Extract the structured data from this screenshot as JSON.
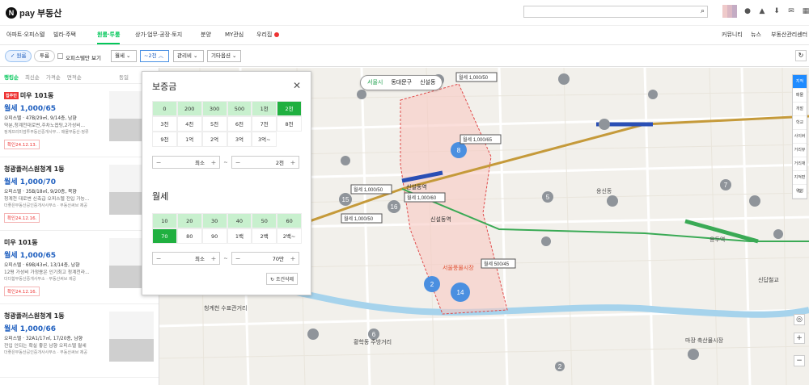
{
  "header": {
    "brand_letter": "N",
    "brand": "pay 부동산",
    "search_placeholder": ""
  },
  "topicons": [
    "chat-icon",
    "bell-icon",
    "download-icon",
    "mail-icon",
    "grid-icon"
  ],
  "nav": {
    "items": [
      "아파트·오피스텔",
      "빌라·주택",
      "원룸·투룸",
      "상가·업무·공장·토지",
      "분양",
      "MY관심",
      "우리집"
    ],
    "active_index": 2,
    "right": [
      "커뮤니티",
      "뉴스",
      "부동산관리센터"
    ]
  },
  "filters": {
    "chip_1": "✓ 원룸",
    "chip_2": "투룸",
    "checkbox_label": "오피스텔만 보기",
    "deal_select": "월세",
    "price_select": "~2천",
    "manage_select": "관리비",
    "other_select": "기타옵션"
  },
  "sort": [
    "랭킹순",
    "최신순",
    "가격순",
    "면적순"
  ],
  "sort_extra": "동일",
  "listings": [
    {
      "tag": "집주인",
      "title": "미우 101동",
      "price": "월세 1,000/65",
      "spec": "오피스텔 · 47B/29㎡, 9/14층, 남향",
      "desc": "약분,청계천대로변,주차노옵팅,2가성비...",
      "agent": "정계프리미엄투부동산중개사무...  매물부동산·정류",
      "date": "확인24.12.13."
    },
    {
      "tag": "",
      "title": "청광플러스원청계 1동",
      "price": "월세 1,000/70",
      "spec": "오피스텔 · 35B/18㎡, 9/20층, 북향",
      "desc": "청계천 대로변 신축급 오피스텔 전입 가능...",
      "agent": "더좋은부동산공인중개사사무소 · 부동산써브 제공",
      "date": "확인24.12.16."
    },
    {
      "tag": "",
      "title": "미우 101동",
      "price": "월세 1,000/65",
      "spec": "오피스텔 · 69B/43㎡, 13/14층, 남향",
      "desc": "12평 가성비 가정용은 인기최고 청계천라...",
      "agent": "더더함부동산중개사무소 · 부동산써브 제공",
      "date": "확인24.12.16."
    },
    {
      "tag": "",
      "title": "청광플러스원청계 1동",
      "price": "월세 1,000/66",
      "spec": "오피스텔 · 32A1/17㎡, 17/20층, 남향",
      "desc": "전입 인되는 확실 좋은 남향 오피스텔 월세",
      "agent": "더좋은부동산공인중개사사무소 · 부동산써브 제공",
      "date": ""
    }
  ],
  "panel": {
    "deposit_title": "보증금",
    "deposit_options": [
      "0",
      "200",
      "300",
      "500",
      "1천",
      "2천",
      "3천",
      "4천",
      "5천",
      "6천",
      "7천",
      "8천",
      "9천",
      "1억",
      "2억",
      "3억",
      "3억~"
    ],
    "deposit_min": "최소",
    "deposit_max": "2천",
    "rent_title": "월세",
    "rent_options": [
      "10",
      "20",
      "30",
      "40",
      "50",
      "60",
      "70",
      "80",
      "90",
      "1백",
      "2백",
      "2백~"
    ],
    "rent_min": "최소",
    "rent_max": "70만",
    "tilde": "~",
    "reset": "조건삭제"
  },
  "location": {
    "city": "서울시",
    "gu": "동대문구",
    "dong": "신설동"
  },
  "map_labels": [
    "월세 1,000/50",
    "월세 1,000/65",
    "월세 1,000/50",
    "월세 1,000/60",
    "월세 1,000/50",
    "월세 500/45",
    "월세 1,000/50",
    "신설동역",
    "신설동역",
    "용신동",
    "용두역",
    "서울풍물시장",
    "청계천 수표관거리",
    "황학동 주방거리",
    "마장 축산물시장",
    "신답철교"
  ],
  "clusters": [
    "8",
    "2",
    "14",
    "16",
    "15",
    "6",
    "7",
    "5",
    "2"
  ],
  "map_controls": [
    "지적",
    "매물",
    "개발",
    "학교",
    "사이버",
    "거리뷰",
    "거리재",
    "지적편집",
    "위성"
  ]
}
